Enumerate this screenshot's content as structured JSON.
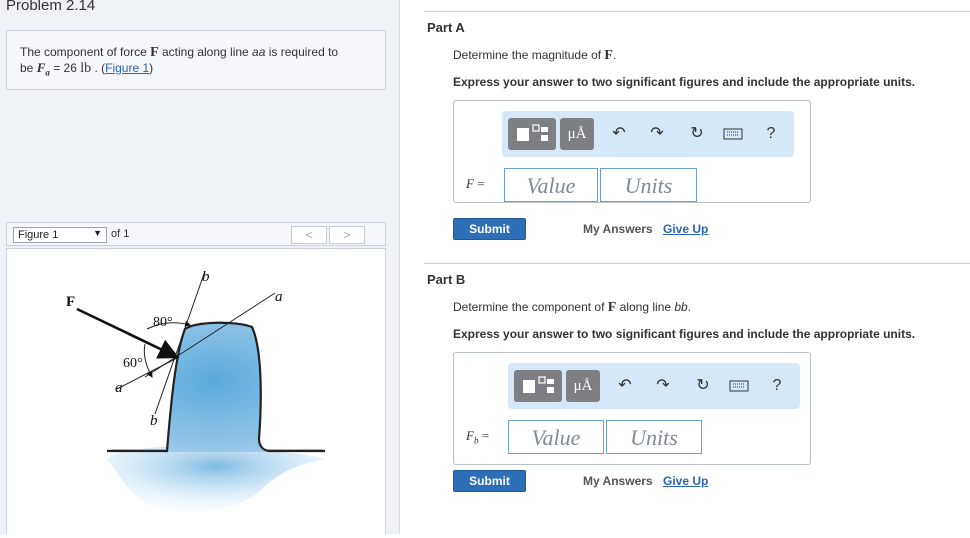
{
  "problem": {
    "title": "Problem 2.14",
    "text_pre": "The component of force ",
    "force_symbol": "F",
    "text_mid": " acting along line ",
    "line_name": "aa",
    "text_post": " is required to",
    "text_line2_pre": "be ",
    "Fa_symbol": "F",
    "Fa_sub": "a",
    "Fa_eq": " = 26 ",
    "Fa_unit": "lb",
    "Fa_period": " . (",
    "figure_link": "Figure 1",
    "close_paren": ")"
  },
  "figure_bar": {
    "selected": "Figure 1",
    "of_text": "of 1",
    "prev": "<",
    "next": ">"
  },
  "diagram": {
    "label_F": "F",
    "label_b_top": "b",
    "label_a_top": "a",
    "label_80": "80°",
    "label_60": "60°",
    "label_a_left": "a",
    "label_b_bottom": "b"
  },
  "parts": [
    {
      "title": "Part A",
      "prompt_pre": "Determine the magnitude of ",
      "prompt_symbol": "F",
      "prompt_post": ".",
      "instruction": "Express your answer to two significant figures and include the appropriate units.",
      "var_label": "F =",
      "value_placeholder": "Value",
      "units_placeholder": "Units",
      "submit": "Submit",
      "my_answers": "My Answers",
      "give_up": "Give Up"
    },
    {
      "title": "Part B",
      "prompt_pre": "Determine the component of ",
      "prompt_symbol": "F",
      "prompt_mid": " along line ",
      "prompt_line": "bb",
      "prompt_post": ".",
      "instruction": "Express your answer to two significant figures and include the appropriate units.",
      "var_label": "Fb =",
      "value_placeholder": "Value",
      "units_placeholder": "Units",
      "submit": "Submit",
      "my_answers": "My Answers",
      "give_up": "Give Up"
    }
  ],
  "toolbar": {
    "units_button": "μÅ",
    "help": "?",
    "icons": [
      "templates-icon",
      "units-icon",
      "undo-icon",
      "redo-icon",
      "reset-icon",
      "keyboard-icon",
      "help-icon"
    ]
  }
}
